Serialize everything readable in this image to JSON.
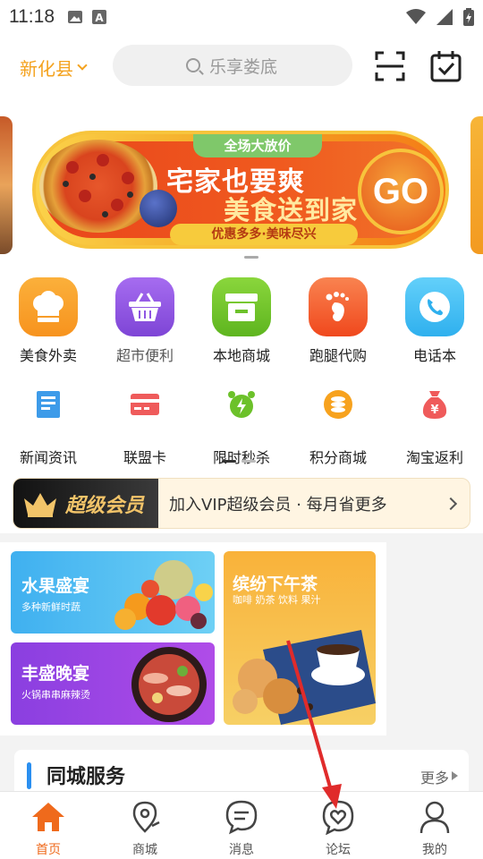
{
  "status_bar": {
    "time": "11:18"
  },
  "header": {
    "location": "新化县",
    "search_placeholder": "乐享娄底"
  },
  "banner": {
    "tag": "全场大放价",
    "title_line1": "宅家也要爽",
    "title_line2": "美食送到家",
    "subtitle": "优惠多多·美味尽兴",
    "go_label": "GO"
  },
  "main_grid": [
    {
      "label": "美食外卖",
      "icon": "chef-hat-icon",
      "color": "#f7931e"
    },
    {
      "label": "超市便利",
      "icon": "basket-icon",
      "color": "#8f55e3"
    },
    {
      "label": "本地商城",
      "icon": "store-icon",
      "color": "#6cc12a"
    },
    {
      "label": "跑腿代购",
      "icon": "footprint-icon",
      "color": "#f45a2e"
    },
    {
      "label": "电话本",
      "icon": "phone-icon",
      "color": "#3cc0f3"
    }
  ],
  "secondary_grid": [
    {
      "label": "新闻资讯",
      "icon": "news-icon",
      "color": "#3d9be9"
    },
    {
      "label": "联盟卡",
      "icon": "card-icon",
      "color": "#ef5b5b"
    },
    {
      "label": "限时秒杀",
      "icon": "alarm-clock-icon",
      "color": "#6cc12a"
    },
    {
      "label": "积分商城",
      "icon": "coins-icon",
      "color": "#f7a21e"
    },
    {
      "label": "淘宝返利",
      "icon": "money-bag-icon",
      "color": "#ef5b5b"
    }
  ],
  "vip": {
    "badge": "超级会员",
    "text": "加入VIP超级会员 · 每月省更多"
  },
  "promos": [
    {
      "title": "水果盛宴",
      "subtitle": "多种新鲜时蔬"
    },
    {
      "title": "丰盛晚宴",
      "subtitle": "火锅串串麻辣烫"
    },
    {
      "title": "缤纷下午茶",
      "subtitle": "咖啡 奶茶 饮料 果汁"
    }
  ],
  "service": {
    "title": "同城服务",
    "more": "更多"
  },
  "bottom_nav": [
    {
      "label": "首页",
      "icon": "home-icon",
      "active": true
    },
    {
      "label": "商城",
      "icon": "map-pin-icon",
      "active": false
    },
    {
      "label": "消息",
      "icon": "message-icon",
      "active": false
    },
    {
      "label": "论坛",
      "icon": "heart-chat-icon",
      "active": false
    },
    {
      "label": "我的",
      "icon": "user-icon",
      "active": false
    }
  ],
  "colors": {
    "accent_orange": "#f4a21e",
    "active_nav": "#ef6a1c",
    "annotation_arrow": "#e02b2b"
  }
}
